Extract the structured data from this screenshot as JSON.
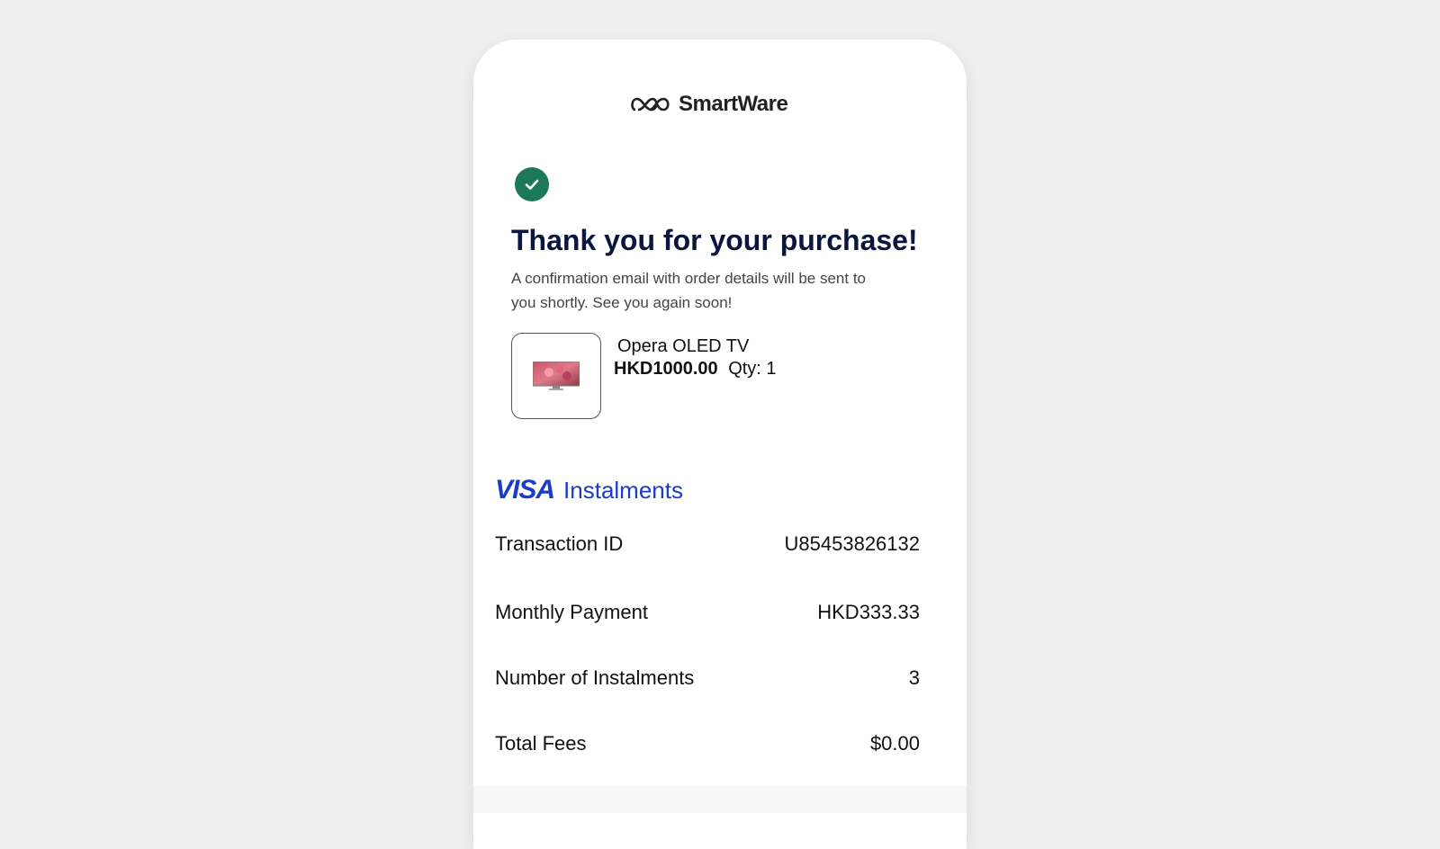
{
  "brand": {
    "name": "SmartWare",
    "logo_icon": "infinity-logo-icon"
  },
  "confirmation": {
    "icon": "check-circle-icon",
    "icon_color": "#1b7a55",
    "title": "Thank you for your purchase!",
    "subtitle": "A confirmation email with order details will be sent to you shortly. See you again soon!"
  },
  "product": {
    "name": "Opera OLED TV",
    "price": "HKD1000.00",
    "qty": "Qty: 1",
    "thumbnail_icon": "tv-icon"
  },
  "payment": {
    "visa_logo": "VISA",
    "method_label": "Instalments",
    "accent_color": "#1a3cc7",
    "details": [
      {
        "label": "Transaction ID",
        "value": "U85453826132"
      },
      {
        "label": "Monthly Payment",
        "value": "HKD333.33"
      },
      {
        "label": "Number of Instalments",
        "value": "3"
      },
      {
        "label": "Total Fees",
        "value": "$0.00"
      }
    ]
  }
}
